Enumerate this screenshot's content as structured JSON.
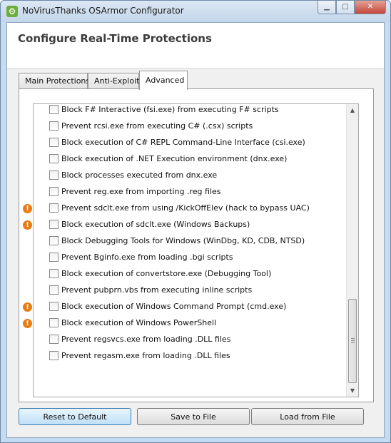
{
  "window": {
    "title": "NoVirusThanks OSArmor Configurator",
    "controls": {
      "minimize": "▁",
      "maximize": "□",
      "close": "✕"
    }
  },
  "header": {
    "title": "Configure Real-Time Protections"
  },
  "tabs": [
    {
      "label": "Main Protections",
      "active": false
    },
    {
      "label": "Anti-Exploit",
      "active": false
    },
    {
      "label": "Advanced",
      "active": true
    }
  ],
  "options": [
    {
      "label": "Block F# Interactive (fsi.exe) from executing F# scripts",
      "checked": false,
      "warning": false
    },
    {
      "label": "Prevent rcsi.exe from executing C# (.csx) scripts",
      "checked": false,
      "warning": false
    },
    {
      "label": "Block execution of C# REPL Command-Line Interface (csi.exe)",
      "checked": false,
      "warning": false
    },
    {
      "label": "Block execution of .NET Execution environment (dnx.exe)",
      "checked": false,
      "warning": false
    },
    {
      "label": "Block processes executed from dnx.exe",
      "checked": false,
      "warning": false
    },
    {
      "label": "Prevent reg.exe from importing .reg files",
      "checked": false,
      "warning": false
    },
    {
      "label": "Prevent sdclt.exe from using /KickOffElev (hack to bypass UAC)",
      "checked": false,
      "warning": true
    },
    {
      "label": "Block execution of sdclt.exe (Windows Backups)",
      "checked": false,
      "warning": true
    },
    {
      "label": "Block Debugging Tools for Windows (WinDbg, KD, CDB, NTSD)",
      "checked": false,
      "warning": false
    },
    {
      "label": "Prevent Bginfo.exe from loading .bgi scripts",
      "checked": false,
      "warning": false
    },
    {
      "label": "Block execution of convertstore.exe (Debugging Tool)",
      "checked": false,
      "warning": false
    },
    {
      "label": "Prevent pubprn.vbs from executing inline scripts",
      "checked": false,
      "warning": false
    },
    {
      "label": "Block execution of Windows Command Prompt (cmd.exe)",
      "checked": false,
      "warning": true
    },
    {
      "label": "Block execution of Windows PowerShell",
      "checked": false,
      "warning": true
    },
    {
      "label": "Prevent regsvcs.exe from loading .DLL files",
      "checked": false,
      "warning": false
    },
    {
      "label": "Prevent regasm.exe from loading .DLL files",
      "checked": false,
      "warning": false
    }
  ],
  "scrollbar": {
    "position": 0.85
  },
  "buttons": {
    "reset": "Reset to Default",
    "save": "Save to File",
    "load": "Load from File"
  },
  "icons": {
    "app": "gear-icon",
    "warning": "warning-icon"
  },
  "colors": {
    "warning": "#ea7b12",
    "title_bar": "#c6dbef",
    "default_button": "#bfe0f6"
  }
}
